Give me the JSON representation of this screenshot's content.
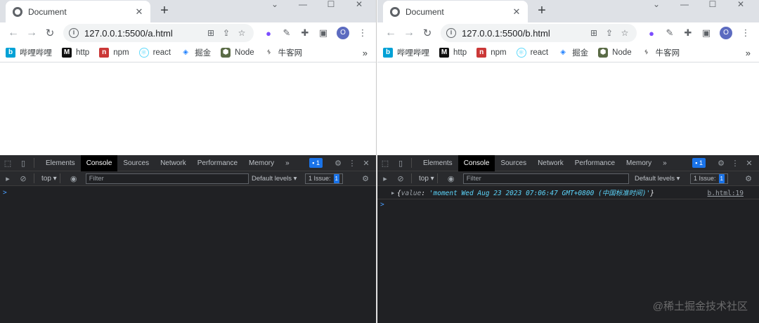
{
  "windows": {
    "a": {
      "tab_title": "Document",
      "url": "127.0.0.1:5500/a.html",
      "avatar_letter": "O",
      "devtools": {
        "tabs": [
          "Elements",
          "Console",
          "Sources",
          "Network",
          "Performance",
          "Memory"
        ],
        "active_tab": "Console",
        "more": "»",
        "message_count": "1",
        "context": "top ▾",
        "filter_placeholder": "Filter",
        "levels": "Default levels ▾",
        "issues_label": "1 Issue:",
        "issues_count": "1",
        "prompt": ">"
      }
    },
    "b": {
      "tab_title": "Document",
      "url": "127.0.0.1:5500/b.html",
      "avatar_letter": "O",
      "devtools": {
        "tabs": [
          "Elements",
          "Console",
          "Sources",
          "Network",
          "Performance",
          "Memory"
        ],
        "active_tab": "Console",
        "more": "»",
        "message_count": "1",
        "context": "top ▾",
        "filter_placeholder": "Filter",
        "levels": "Default levels ▾",
        "issues_label": "1 Issue:",
        "issues_count": "1",
        "log": {
          "open": "{",
          "key": "value",
          "colon": ": ",
          "string": "'moment Wed Aug 23 2023 07:06:47 GMT+0800 (中国标准时间)'",
          "close": "}",
          "source": "b.html:19"
        },
        "prompt": ">"
      }
    }
  },
  "bookmarks": [
    {
      "label": "哔哩哔哩",
      "icon": "bilibili-icon",
      "glyph": "b"
    },
    {
      "label": "http",
      "icon": "http-icon",
      "glyph": "M"
    },
    {
      "label": "npm",
      "icon": "npm-icon",
      "glyph": "n"
    },
    {
      "label": "react",
      "icon": "react-icon",
      "glyph": "⚛"
    },
    {
      "label": "掘金",
      "icon": "juejin-icon",
      "glyph": "◈"
    },
    {
      "label": "Node",
      "icon": "node-icon",
      "glyph": "⬢"
    },
    {
      "label": "牛客网",
      "icon": "nowcoder-icon",
      "glyph": "ᛃ"
    }
  ],
  "bookmarks_more": "»",
  "watermark": "@稀土掘金技术社区",
  "colors": {
    "accent": "#1a73e8",
    "devtools_bg": "#202124",
    "string_value": "#5cd5fb"
  }
}
